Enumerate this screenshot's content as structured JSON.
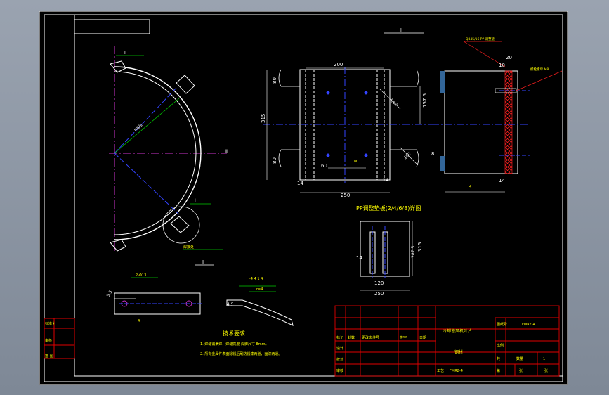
{
  "colors": {
    "background": "#000000",
    "frame": "#ffffff",
    "dimension": "#ffffff",
    "leader": "#00cc00",
    "centerline": "#3344ff",
    "axis": "#cc33cc",
    "table": "#e00000",
    "note_text": "#ffff00",
    "hatch": "#ff2020"
  },
  "views": {
    "section_top": "II",
    "section_bottom": "I",
    "half_ring_dim_label": "R直径",
    "half_ring_leader_a": "I",
    "half_ring_leader_b": "I",
    "half_ring_detail_label": "焊接处",
    "half_ring_small_label": "Ⅱ"
  },
  "plate_view": {
    "dims": {
      "top_width": "200",
      "left_top_h": "80",
      "left_total_h": "315",
      "left_bottom_h": "80",
      "right_h": "157.5",
      "hole_spacing": "60",
      "left_offset": "14",
      "right_offset": "14",
      "total_width": "250",
      "diag_top": "R50",
      "diag_bottom": "100",
      "small_m": "M"
    }
  },
  "side_view": {
    "dims": {
      "top": "20",
      "inner": "10",
      "left_mark": "8",
      "bottom_mark": "4",
      "bottom_right": "14"
    },
    "note_top": "Q345/16 PP 调整垫",
    "note_right": "螺栓螺母 M8"
  },
  "detail_view": {
    "title": "PP调整垫板(2/4/6/8)详图",
    "dims": {
      "height": "315",
      "inner_height": "287.5",
      "slot_width": "120",
      "width": "250",
      "left": "14"
    }
  },
  "small_parts": {
    "dim_35": "3.5",
    "label_holes": "2-Φ13",
    "bottom_mark": "4",
    "right_dim": "4.5",
    "right_note_a": "-4 4 1 4",
    "right_note_b": "r=4"
  },
  "tech_notes": {
    "title": "技术要求",
    "line1": "1. 焊缝需满焊，焊缝高度 焊脚尺寸 8mm。",
    "line2": "2. 所有金属件表面除锈后刷防锈漆两道，面漆两道。"
  },
  "left_stamps": [
    "标准化",
    "审核",
    "描 图"
  ],
  "title_block": {
    "drawing_name": "冷却塔风机叶片",
    "drawing_no_label": "图纸号",
    "drawing_no": "FMRZ-4",
    "scale_label": "比例",
    "qty_label": "数量",
    "qty": "1",
    "material": "钢材",
    "sheet_label": "共",
    "sheet_of": "张",
    "designer_label": "设计",
    "checker_label": "校对",
    "approve_label": "审核",
    "process_label": "工艺",
    "mark_label": "标记",
    "count_label": "处数",
    "change_label": "更改文件号",
    "sign_label": "签字",
    "date_label": "日期",
    "part_no": "FMRZ-4",
    "sheet_word": "第",
    "page_word": "张"
  }
}
